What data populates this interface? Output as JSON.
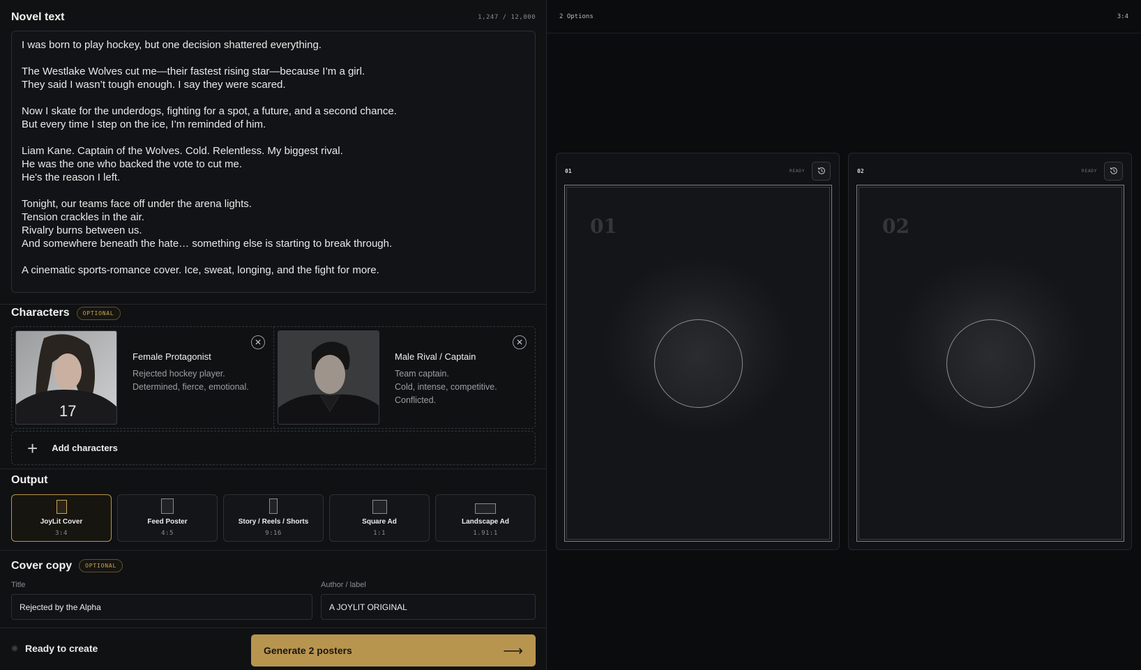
{
  "novel": {
    "title": "Novel text",
    "counter": "1,247 / 12,000",
    "text": "I was born to play hockey, but one decision shattered everything.\n\nThe Westlake Wolves cut me—their fastest rising star—because I’m a girl.\nThey said I wasn’t tough enough. I say they were scared.\n\nNow I skate for the underdogs, fighting for a spot, a future, and a second chance.\nBut every time I step on the ice, I’m reminded of him.\n\nLiam Kane. Captain of the Wolves. Cold. Relentless. My biggest rival.\nHe was the one who backed the vote to cut me.\nHe's the reason I left.\n\nTonight, our teams face off under the arena lights.\nTension crackles in the air.\nRivalry burns between us.\nAnd somewhere beneath the hate… something else is starting to break through.\n\nA cinematic sports-romance cover. Ice, sweat, longing, and the fight for more."
  },
  "characters": {
    "title": "Characters",
    "badge": "OPTIONAL",
    "items": [
      {
        "name": "Female Protagonist",
        "desc": "Rejected hockey player.\nDetermined, fierce, emotional.",
        "jersey": "17"
      },
      {
        "name": "Male Rival / Captain",
        "desc": "Team captain.\nCold, intense, competitive.\nConflicted."
      }
    ],
    "add_label": "Add characters"
  },
  "output": {
    "title": "Output",
    "options": [
      {
        "label": "JoyLit Cover",
        "ratio": "3:4",
        "selected": true
      },
      {
        "label": "Feed Poster",
        "ratio": "4:5",
        "selected": false
      },
      {
        "label": "Story / Reels / Shorts",
        "ratio": "9:16",
        "selected": false
      },
      {
        "label": "Square Ad",
        "ratio": "1:1",
        "selected": false
      },
      {
        "label": "Landscape Ad",
        "ratio": "1.91:1",
        "selected": false
      }
    ]
  },
  "cover_copy": {
    "title": "Cover copy",
    "badge": "OPTIONAL",
    "title_label": "Title",
    "title_value": "Rejected by the Alpha",
    "author_label": "Author / label",
    "author_value": "A JOYLIT ORIGINAL"
  },
  "footer": {
    "status": "Ready to create",
    "generate_label": "Generate 2 posters",
    "arrow": "⟶"
  },
  "preview": {
    "options_label": "2 Options",
    "ratio": "3:4",
    "posters": [
      {
        "num": "01",
        "status": "READY",
        "big_num": "01"
      },
      {
        "num": "02",
        "status": "READY",
        "big_num": "02"
      }
    ]
  },
  "colors": {
    "accent": "#b8954f",
    "background": "#0c0d0f",
    "panel": "#101113"
  }
}
